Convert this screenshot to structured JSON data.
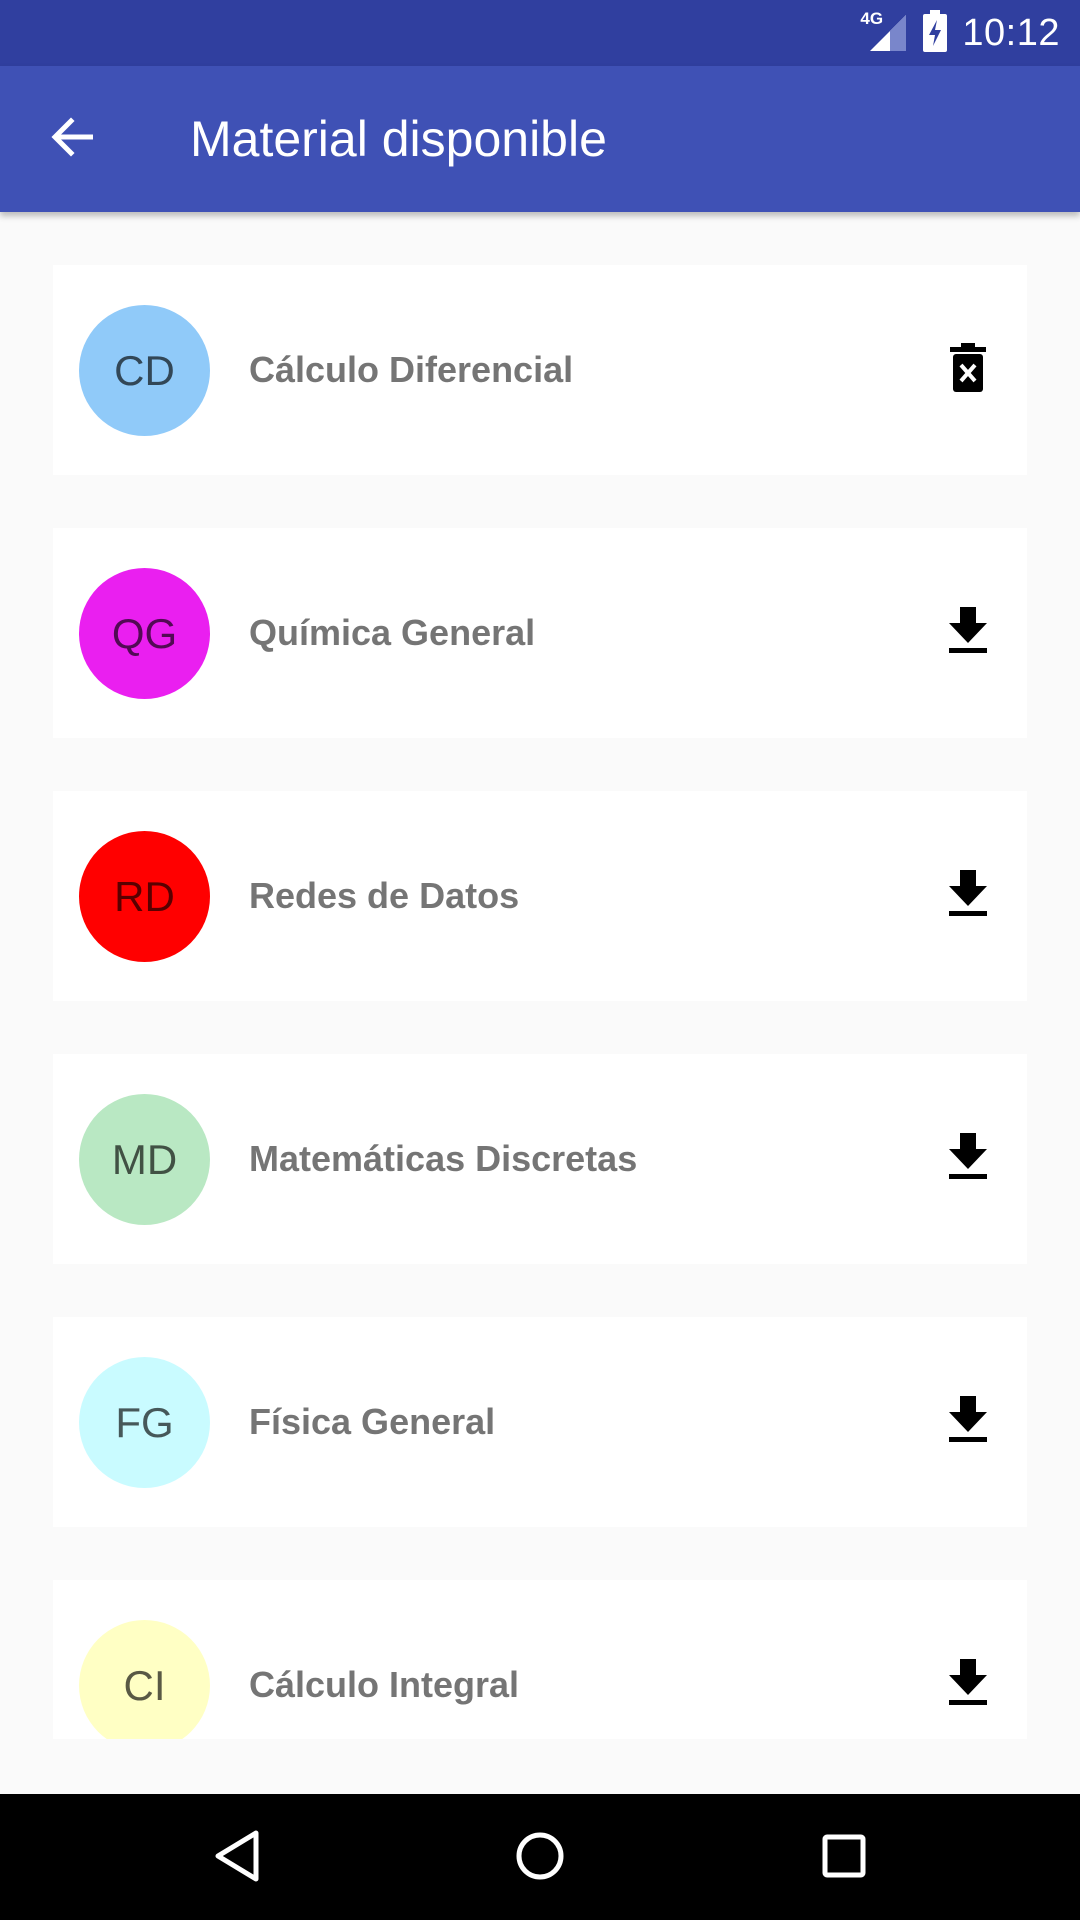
{
  "status_bar": {
    "time": "10:12",
    "network": "4G",
    "icons": [
      "signal-icon",
      "battery-charging-icon"
    ]
  },
  "app_bar": {
    "title": "Material disponible",
    "back_icon": "arrow-back-icon"
  },
  "subjects": [
    {
      "initials": "CD",
      "name": "Cálculo Diferencial",
      "color": "#90caf9",
      "action_icon": "delete-forever-icon"
    },
    {
      "initials": "QG",
      "name": "Química General",
      "color": "#ea1ff0",
      "action_icon": "download-icon"
    },
    {
      "initials": "RD",
      "name": "Redes de Datos",
      "color": "#ff0000",
      "action_icon": "download-icon"
    },
    {
      "initials": "MD",
      "name": "Matemáticas Discretas",
      "color": "#b9e8c3",
      "action_icon": "download-icon"
    },
    {
      "initials": "FG",
      "name": "Física General",
      "color": "#c9fbff",
      "action_icon": "download-icon"
    },
    {
      "initials": "CI",
      "name": "Cálculo Integral",
      "color": "#ffffc4",
      "action_icon": "download-icon"
    }
  ],
  "nav_bar": {
    "icons": [
      "back-triangle-icon",
      "home-circle-icon",
      "recents-square-icon"
    ]
  }
}
